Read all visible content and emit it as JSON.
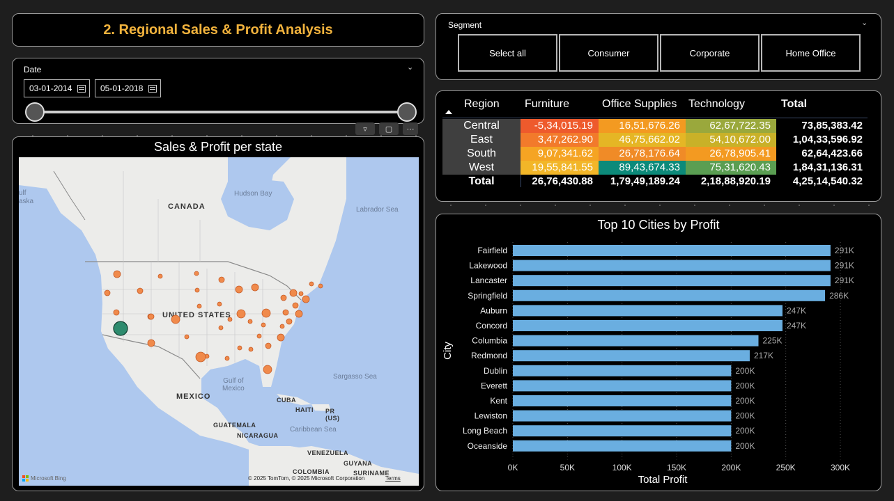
{
  "header": {
    "title": "2. Regional Sales & Profit Analysis"
  },
  "date_slicer": {
    "title": "Date",
    "start_date": "03-01-2014",
    "end_date": "05-01-2018"
  },
  "segment_slicer": {
    "title": "Segment",
    "options": [
      "Select all",
      "Consumer",
      "Corporate",
      "Home Office"
    ]
  },
  "map_visual": {
    "title": "Sales & Profit per state",
    "labels": {
      "canada": "CANADA",
      "usa": "UNITED STATES",
      "mexico": "MEXICO",
      "cuba": "CUBA",
      "haiti": "HAITI",
      "pr": "PR\n(US)",
      "guatemala": "GUATEMALA",
      "nicaragua": "NICARAGUA",
      "venezuela": "VENEZUELA",
      "guyana": "GUYANA",
      "suriname": "SURINAME",
      "colombia": "COLOMBIA",
      "hudson_bay": "Hudson Bay",
      "labrador_sea": "Labrador Sea",
      "gulf_mexico": "Gulf of\nMexico",
      "sargasso_sea": "Sargasso Sea",
      "caribbean_sea": "Caribbean Sea",
      "gulf_alaska": "ulf\naska"
    },
    "attribution": "© 2025 TomTom, © 2025 Microsoft Corporation",
    "terms": "Terms",
    "bing": "Microsoft Bing",
    "colors": {
      "bubble": "#f08a4b",
      "highlight": "#2e8b6e",
      "water": "#aec8ee",
      "land": "#ececec"
    }
  },
  "matrix": {
    "columns": [
      "Region",
      "Furniture",
      "Office Supplies",
      "Technology",
      "Total"
    ],
    "rows": [
      {
        "region": "Central",
        "cells": [
          "-5,34,015.19",
          "16,51,676.26",
          "62,67,722.35"
        ],
        "colors": [
          "#ee5a2c",
          "#f39a21",
          "#9aa83c"
        ],
        "total": "73,85,383.42"
      },
      {
        "region": "East",
        "cells": [
          "3,47,262.90",
          "46,75,662.02",
          "54,10,672.00"
        ],
        "colors": [
          "#f27a2b",
          "#e5b625",
          "#c9b128"
        ],
        "total": "1,04,33,596.92"
      },
      {
        "region": "South",
        "cells": [
          "9,07,341.62",
          "26,78,176.64",
          "26,78,905.41"
        ],
        "colors": [
          "#f5a423",
          "#f08b27",
          "#f39a21"
        ],
        "total": "62,64,423.66"
      },
      {
        "region": "West",
        "cells": [
          "19,55,841.55",
          "89,43,674.33",
          "75,31,620.43"
        ],
        "colors": [
          "#f2b628",
          "#0c8a7a",
          "#5a9e52"
        ],
        "total": "1,84,31,136.31"
      }
    ],
    "totals": {
      "label": "Total",
      "cells": [
        "26,76,430.88",
        "1,79,49,189.24",
        "2,18,88,920.19"
      ],
      "total": "4,25,14,540.32"
    }
  },
  "chart_data": {
    "type": "bar",
    "orientation": "horizontal",
    "title": "Top 10 Cities by Profit",
    "xlabel": "Total Profit",
    "ylabel": "City",
    "categories": [
      "Fairfield",
      "Lakewood",
      "Lancaster",
      "Springfield",
      "Auburn",
      "Concord",
      "Columbia",
      "Redmond",
      "Dublin",
      "Everett",
      "Kent",
      "Lewiston",
      "Long Beach",
      "Oceanside"
    ],
    "values": [
      291000,
      291000,
      291000,
      286000,
      247000,
      247000,
      225000,
      217000,
      200000,
      200000,
      200000,
      200000,
      200000,
      200000
    ],
    "data_labels": [
      "291K",
      "291K",
      "291K",
      "286K",
      "247K",
      "247K",
      "225K",
      "217K",
      "200K",
      "200K",
      "200K",
      "200K",
      "200K",
      "200K"
    ],
    "xticks": [
      "0K",
      "50K",
      "100K",
      "150K",
      "200K",
      "250K",
      "300K"
    ],
    "xlim": [
      0,
      300000
    ],
    "bar_color": "#6aaee0",
    "grid": true
  }
}
